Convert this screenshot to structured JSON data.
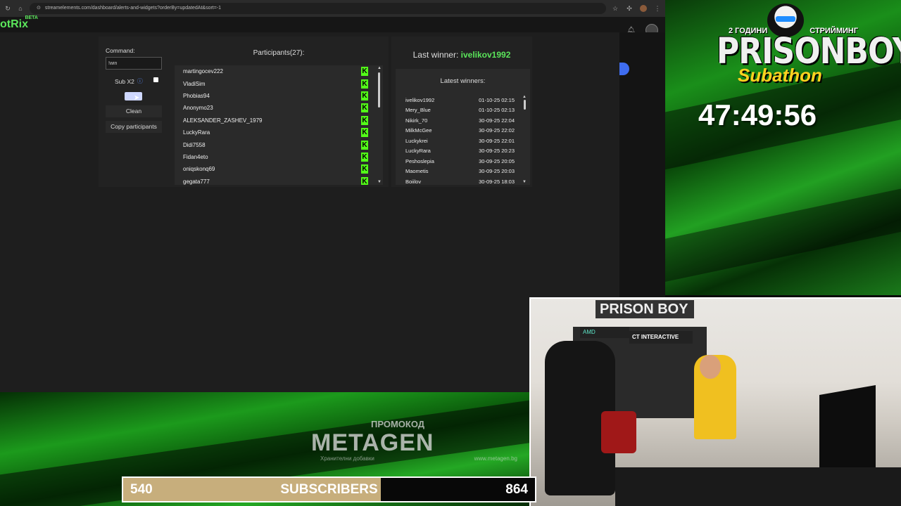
{
  "browser": {
    "url": "streamelements.com/dashboard/alerts-and-widgets?orderBy=updatedAt&sort=-1"
  },
  "app": {
    "logo": "otRix",
    "logo_badge": "BETA"
  },
  "controls": {
    "command_label": "Command:",
    "command_value": "!win",
    "sub_x2_label": "Sub X2",
    "clean_label": "Clean",
    "copy_label": "Copy participants"
  },
  "participants": {
    "title": "Participants(27):",
    "items": [
      "martingocev222",
      "VladiSim",
      "Phobias94",
      "Anonymo23",
      "ALEKSANDER_ZASHEV_1979",
      "LuckyRara",
      "Didi7558",
      "Fidan4eto",
      "oniqskonq69",
      "gegata777"
    ]
  },
  "winners": {
    "last_prefix": "Last winner: ",
    "last_name": "ivelikov1992",
    "latest_title": "Latest winners:",
    "rows": [
      {
        "name": "ivelikov1992",
        "time": "01-10-25 02:15"
      },
      {
        "name": "Mery_Blue",
        "time": "01-10-25 02:13"
      },
      {
        "name": "Nikirk_70",
        "time": "30-09-25 22:04"
      },
      {
        "name": "MilkMcGee",
        "time": "30-09-25 22:02"
      },
      {
        "name": "Luckykrei",
        "time": "30-09-25 22:01"
      },
      {
        "name": "LuckyRara",
        "time": "30-09-25 20:23"
      },
      {
        "name": "Peshoslepia",
        "time": "30-09-25 20:05"
      },
      {
        "name": "Maometis",
        "time": "30-09-25 20:03"
      },
      {
        "name": "Boiilov",
        "time": "30-09-25 18:03"
      }
    ]
  },
  "overlay": {
    "top_left": "2 ГОДИНИ",
    "top_right": "СТРИЙМИНГ",
    "channel": "PRISONBOY",
    "event": "Subathon",
    "timer": "47:49:56",
    "promo_label": "ПРОМОКОД",
    "promo_brand": "METAGEN",
    "promo_sub_left": "Хранителни добавки",
    "promo_sub_right": "www.metagen.bg",
    "subs_current": "540",
    "subs_label": "SUBSCRIBERS",
    "subs_goal": "864",
    "subs_fraction": 0.625
  },
  "webcam": {
    "sign1": "PRISON BOY",
    "sign2": "AMD",
    "sign3": "CT INTERACTIVE"
  },
  "colors": {
    "accent_green": "#5be65b",
    "kick_green": "#53fc18",
    "sub_fill": "#c7ae7c"
  }
}
